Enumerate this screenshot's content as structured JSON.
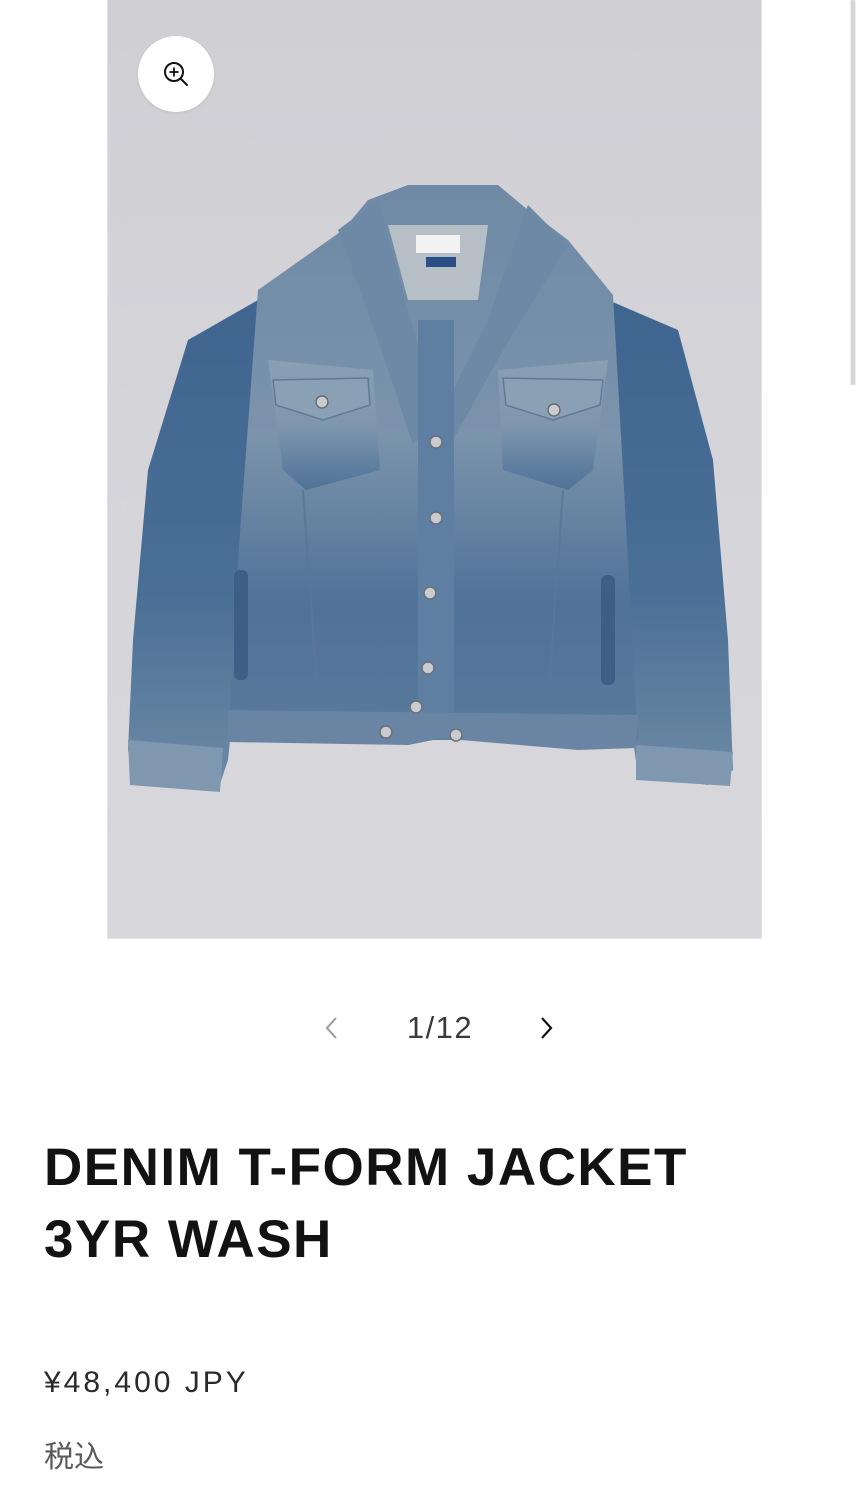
{
  "gallery": {
    "image_alt": "DENIM T-FORM JACKET 3YR WASH",
    "zoom_icon": "zoom-in-icon",
    "counter": "1/12",
    "prev_icon": "chevron-left-icon",
    "next_icon": "chevron-right-icon"
  },
  "product": {
    "title_line1": "DENIM T-FORM JACKET",
    "title_line2": "3YR WASH",
    "price": "¥48,400 JPY",
    "tax_note": "税込"
  },
  "colors": {
    "text": "#121212",
    "muted": "#5a5a5a",
    "image_background": "#d4d4d9",
    "denim": "#4a6f96"
  }
}
